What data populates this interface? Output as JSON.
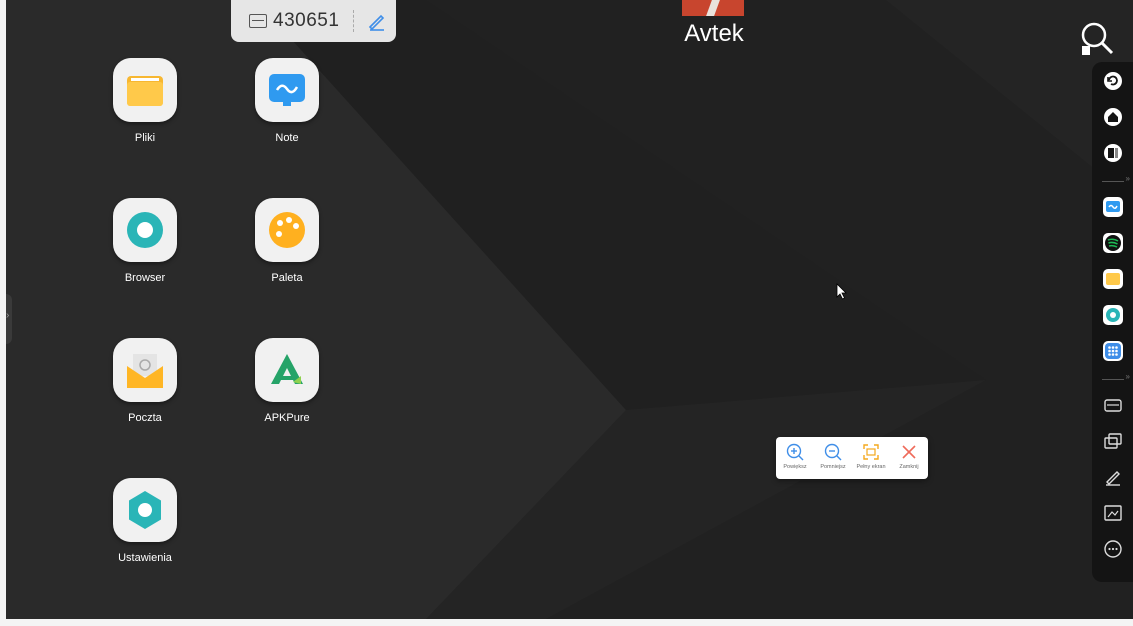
{
  "top_bar": {
    "room_code": "430651"
  },
  "brand": {
    "name": "Avtek"
  },
  "apps": [
    {
      "label": "Pliki",
      "icon": "folder-icon"
    },
    {
      "label": "Note",
      "icon": "whiteboard-icon"
    },
    {
      "label": "Browser",
      "icon": "browser-icon"
    },
    {
      "label": "Paleta",
      "icon": "palette-icon"
    },
    {
      "label": "Poczta",
      "icon": "mail-icon"
    },
    {
      "label": "APKPure",
      "icon": "apkpure-icon"
    },
    {
      "label": "Ustawienia",
      "icon": "settings-icon"
    }
  ],
  "dock": {
    "items": [
      "back-icon",
      "home-icon",
      "recent-apps-icon",
      "note-app-icon",
      "spotify-icon",
      "files-app-icon",
      "browser-app-icon",
      "all-apps-icon",
      "id-card-icon",
      "screen-share-icon",
      "pen-icon",
      "screenshot-icon",
      "more-icon"
    ]
  },
  "float_toolbar": {
    "zoom_in": "Powiększ",
    "zoom_out": "Pomniejsz",
    "fullscreen": "Pełny ekran",
    "close": "Zamknij"
  }
}
